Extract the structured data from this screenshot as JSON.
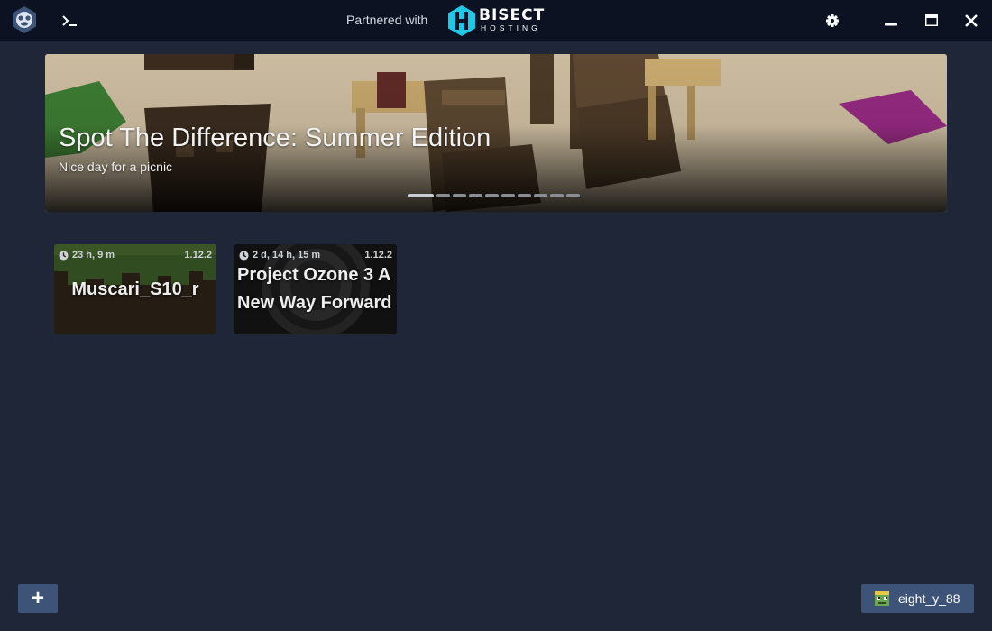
{
  "titlebar": {
    "partner_text": "Partnered with",
    "partner_brand": "BISECT",
    "partner_brand_sub": "HOSTING",
    "icons": {
      "logo": "gdlauncher-logo-icon",
      "terminal": "terminal-icon",
      "settings": "gear-icon",
      "minimize": "minimize-icon",
      "maximize": "maximize-icon",
      "close": "close-icon"
    }
  },
  "news": {
    "title": "Spot The Difference: Summer Edition",
    "subtitle": "Nice day for a picnic",
    "slide_count": 10,
    "active_slide": 0
  },
  "instances": [
    {
      "name": "Muscari_S10_r",
      "played": "23 h, 9 m",
      "version": "1.12.2"
    },
    {
      "name": "Project Ozone 3 A New Way Forward",
      "played": "2 d, 14 h, 15 m",
      "version": "1.12.2"
    }
  ],
  "footer": {
    "add_label": "+",
    "account_name": "eight_y_88"
  },
  "colors": {
    "titlebar_bg": "#0c1221",
    "app_bg": "#1f2637",
    "button_bg": "#3d5378",
    "bisect_accent": "#1ec8e8"
  }
}
